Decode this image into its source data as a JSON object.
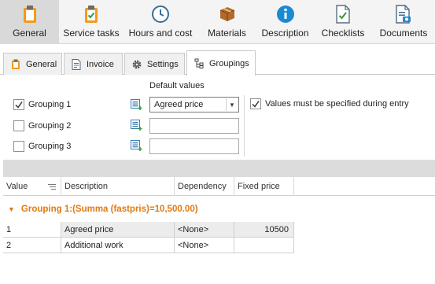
{
  "toolbar": {
    "items": [
      {
        "label": "General",
        "active": true,
        "icon": "clipboard-icon"
      },
      {
        "label": "Service tasks",
        "active": false,
        "icon": "clipboard-check-icon"
      },
      {
        "label": "Hours and cost",
        "active": false,
        "icon": "clock-icon"
      },
      {
        "label": "Materials",
        "active": false,
        "icon": "box-icon"
      },
      {
        "label": "Description",
        "active": false,
        "icon": "info-icon"
      },
      {
        "label": "Checklists",
        "active": false,
        "icon": "checklist-icon"
      },
      {
        "label": "Documents",
        "active": false,
        "icon": "documents-icon"
      }
    ]
  },
  "tabs": [
    {
      "label": "General",
      "icon": "clipboard-icon",
      "active": false
    },
    {
      "label": "Invoice",
      "icon": "invoice-icon",
      "active": false
    },
    {
      "label": "Settings",
      "icon": "gear-icon",
      "active": false
    },
    {
      "label": "Groupings",
      "icon": "groupings-icon",
      "active": true
    }
  ],
  "groupings": {
    "default_values_label": "Default values",
    "rows": [
      {
        "label": "Grouping 1",
        "checked": true,
        "value": "Agreed price"
      },
      {
        "label": "Grouping 2",
        "checked": false,
        "value": ""
      },
      {
        "label": "Grouping 3",
        "checked": false,
        "value": ""
      }
    ],
    "must_specify_label": "Values must be specified during entry",
    "must_specify_checked": true
  },
  "grid": {
    "columns": [
      "Value",
      "Description",
      "Dependency",
      "Fixed price"
    ],
    "group_label": "Grouping 1:(Summa (fastpris)=10,500.00)",
    "rows": [
      {
        "value": "1",
        "description": "Agreed price",
        "dependency": "<None>",
        "fixed_price": "10500"
      },
      {
        "value": "2",
        "description": "Additional work",
        "dependency": "<None>",
        "fixed_price": ""
      }
    ]
  },
  "colors": {
    "accent_orange": "#e07a13",
    "clipboard_orange": "#f29a1e",
    "info_blue": "#1a8ad3"
  }
}
